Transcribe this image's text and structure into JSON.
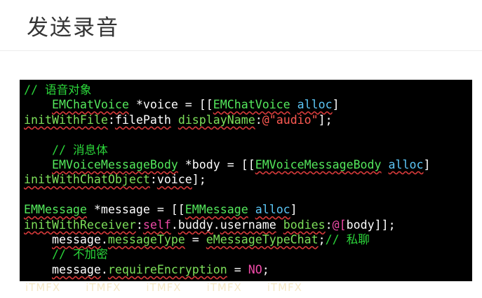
{
  "header": {
    "title": "发送录音"
  },
  "code": {
    "l1_comment": "// 语音对象",
    "l2_type": "EMChatVoice",
    "l2_text": " *voice = [[",
    "l2_type2": "EMChatVoice",
    "l2_sp": " ",
    "l2_alloc": "alloc",
    "l2_end": "]",
    "l3_method": "initWithFile",
    "l3_colon": ":",
    "l3_arg": "filePath",
    "l3_sp": " ",
    "l3_method2": "displayName",
    "l3_colon2": ":",
    "l3_str": "@\"audio\"",
    "l3_end": "];",
    "l5_comment": "// 消息体",
    "l6_type": "EMVoiceMessageBody",
    "l6_text": " *body = [[",
    "l6_type2": "EMVoiceMessageBody",
    "l6_sp": " ",
    "l6_alloc": "alloc",
    "l6_end": "]",
    "l7_method": "initWithChatObject",
    "l7_colon": ":",
    "l7_arg": "voice",
    "l7_end": "];",
    "l9_type": "EMMessage",
    "l9_text": " *message = [[",
    "l9_type2": "EMMessage",
    "l9_sp": " ",
    "l9_alloc": "alloc",
    "l9_end": "]",
    "l10_method": "initWithReceiver",
    "l10_colon": ":",
    "l10_self": "self",
    "l10_dot1": ".",
    "l10_buddy": "buddy",
    "l10_dot2": ".",
    "l10_username": "username",
    "l10_sp": " ",
    "l10_method2": "bodies",
    "l10_colon2": ":",
    "l10_arr": "@[",
    "l10_body": "body",
    "l10_end": "]];",
    "l11_msg": "message",
    "l11_dot": ".",
    "l11_prop": "messageType",
    "l11_eq": " = ",
    "l11_val": "eMessageTypeChat",
    "l11_semi": ";",
    "l11_comment": "// 私聊",
    "l12_comment": "// 不加密",
    "l13_msg": "message",
    "l13_dot": ".",
    "l13_prop": "requireEncryption",
    "l13_eq": " = ",
    "l13_val": "NO",
    "l13_semi": ";"
  },
  "watermark": [
    "iTMFX",
    "iTMFX",
    "iTMFX",
    "iTMFX",
    "iTMFX"
  ]
}
